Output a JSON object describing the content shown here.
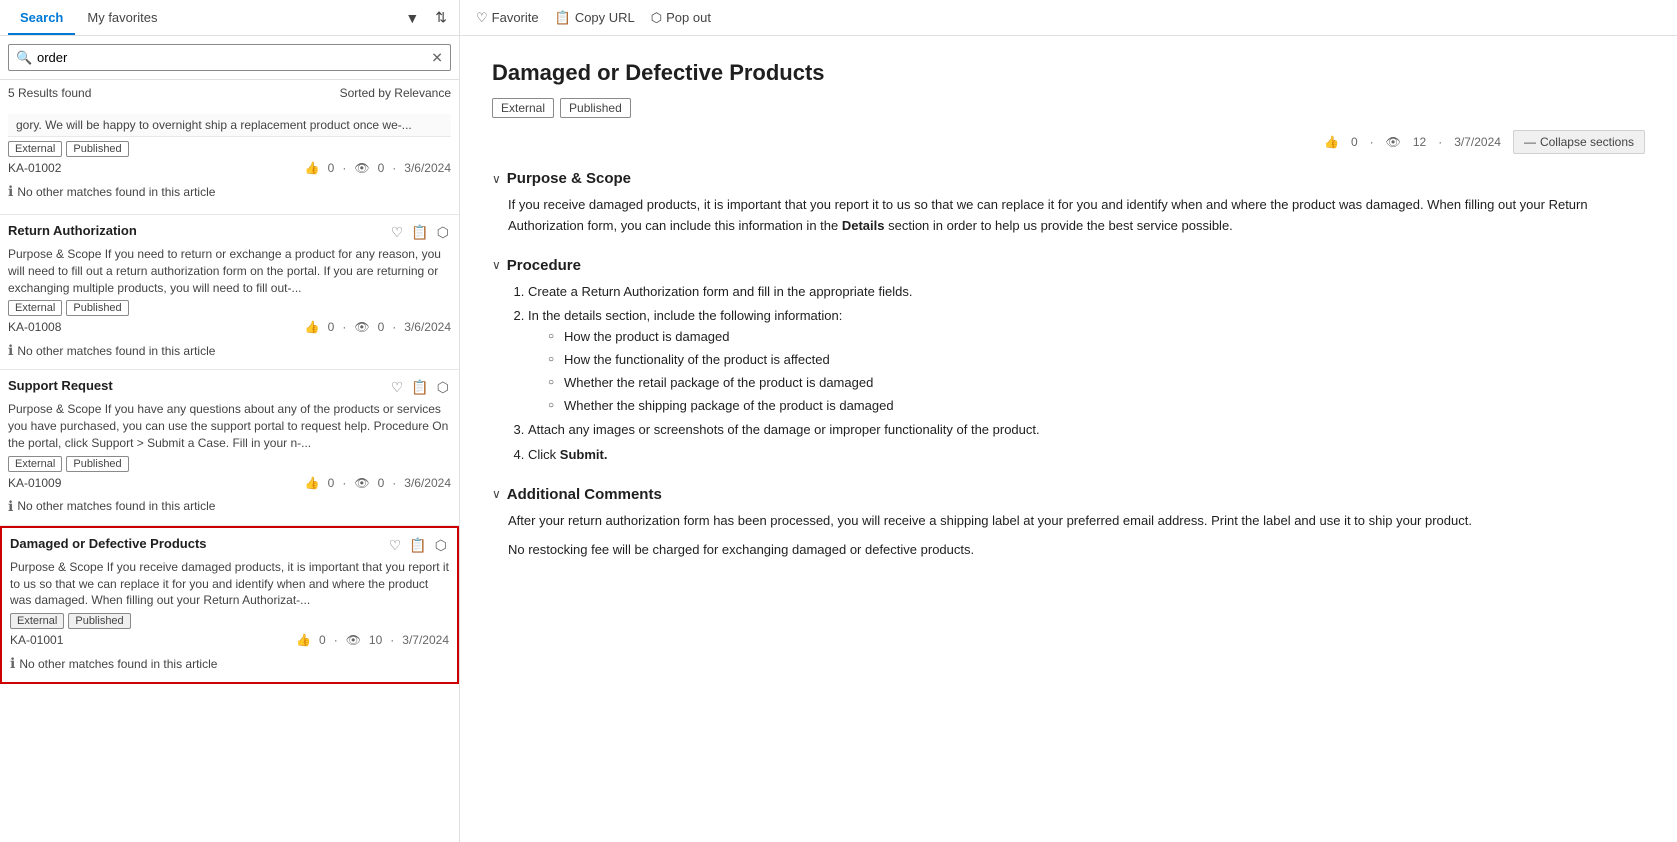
{
  "tabs": {
    "search": "Search",
    "favorites": "My favorites"
  },
  "search": {
    "value": "order",
    "placeholder": "order",
    "results_count": "5 Results found",
    "sorted_by": "Sorted by Relevance"
  },
  "results": [
    {
      "id": "first-snippet",
      "snippet": "gory. We will be happy to overnight ship a replacement product once we-...",
      "tags": [
        "External",
        "Published"
      ],
      "ka": "KA-01002",
      "likes": "0",
      "views": "0",
      "date": "3/6/2024",
      "no_match": "No other matches found in this article"
    },
    {
      "id": "return-auth",
      "title": "Return Authorization",
      "snippet": "Purpose & Scope If you need to return or exchange a product for any reason, you will need to fill out a return authorization form on the portal. If you are returning or exchanging multiple products, you will need to fill out-...",
      "tags": [
        "External",
        "Published"
      ],
      "ka": "KA-01008",
      "likes": "0",
      "views": "0",
      "date": "3/6/2024",
      "no_match": "No other matches found in this article"
    },
    {
      "id": "support-request",
      "title": "Support Request",
      "snippet": "Purpose & Scope If you have any questions about any of the products or services you have purchased, you can use the support portal to request help. Procedure On the portal, click Support > Submit a Case. Fill in your n-...",
      "tags": [
        "External",
        "Published"
      ],
      "ka": "KA-01009",
      "likes": "0",
      "views": "0",
      "date": "3/6/2024",
      "no_match": "No other matches found in this article"
    },
    {
      "id": "damaged-defective",
      "title": "Damaged or Defective Products",
      "snippet": "Purpose & Scope If you receive damaged products, it is important that you report it to us so that we can replace it for you and identify when and where the product was damaged. When filling out your Return Authorizat-...",
      "tags": [
        "External",
        "Published"
      ],
      "ka": "KA-01001",
      "likes": "0",
      "views": "10",
      "date": "3/7/2024",
      "no_match": "No other matches found in this article",
      "selected": true
    }
  ],
  "toolbar": {
    "favorite": "Favorite",
    "copy_url": "Copy URL",
    "pop_out": "Pop out"
  },
  "article": {
    "title": "Damaged or Defective Products",
    "tags": [
      "External",
      "Published"
    ],
    "likes": "0",
    "views": "12",
    "date": "3/7/2024",
    "collapse_label": "Collapse sections",
    "sections": [
      {
        "id": "purpose",
        "title": "Purpose & Scope",
        "body": "If you receive damaged products, it is important that you report it to us so that we can replace it for you and identify when and where the product was damaged. When filling out your Return Authorization form, you can include this information in the Details section in order to help us provide the best service possible."
      },
      {
        "id": "procedure",
        "title": "Procedure",
        "steps": [
          "Create a Return Authorization form and fill in the appropriate fields.",
          "In the details section, include the following information:",
          "Attach any images or screenshots of the damage or improper functionality of the product.",
          "Click Submit."
        ],
        "sub_items": [
          "How the product is damaged",
          "How the functionality of the product is affected",
          "Whether the retail package of the product is damaged",
          "Whether the shipping package of the product is damaged"
        ]
      },
      {
        "id": "comments",
        "title": "Additional Comments",
        "body1": "After your return authorization form has been processed, you will receive a shipping label at your preferred email address. Print the label and use it to ship your product.",
        "body2": "No restocking fee will be charged for exchanging damaged or defective products."
      }
    ]
  }
}
